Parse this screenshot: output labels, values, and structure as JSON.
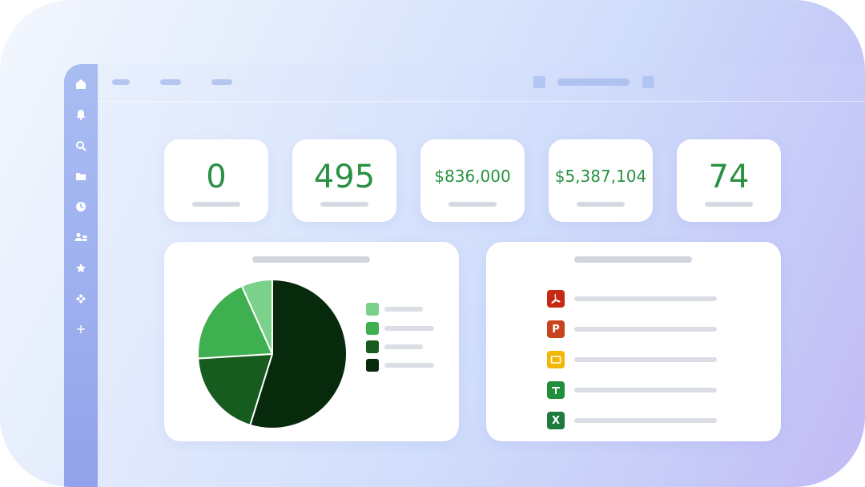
{
  "stats": [
    {
      "value": "0",
      "size": "big"
    },
    {
      "value": "495",
      "size": "big"
    },
    {
      "value": "$836,000",
      "size": "small"
    },
    {
      "value": "$5,387,104",
      "size": "small"
    },
    {
      "value": "74",
      "size": "big"
    }
  ],
  "sidebar": {
    "icons": [
      "home-icon",
      "bell-icon",
      "search-icon",
      "folder-icon",
      "clock-icon",
      "people-icon",
      "star-icon",
      "apps-icon",
      "plus-icon"
    ]
  },
  "chart_data": {
    "type": "pie",
    "values": [
      7,
      20,
      20,
      57
    ],
    "colors": [
      "#7bd18a",
      "#3fb04f",
      "#165c1e",
      "#072a0c"
    ]
  },
  "files": {
    "icons": [
      {
        "name": "pdf-file-icon",
        "glyph": "",
        "color": "#c62a12"
      },
      {
        "name": "slides-file-icon",
        "glyph": "P",
        "color": "#c8441f"
      },
      {
        "name": "presentation-file-icon",
        "glyph": "",
        "color": "#f2b705"
      },
      {
        "name": "sheets-file-icon",
        "glyph": "",
        "color": "#1f8f3c"
      },
      {
        "name": "excel-file-icon",
        "glyph": "X",
        "color": "#1e7a3f"
      }
    ]
  }
}
